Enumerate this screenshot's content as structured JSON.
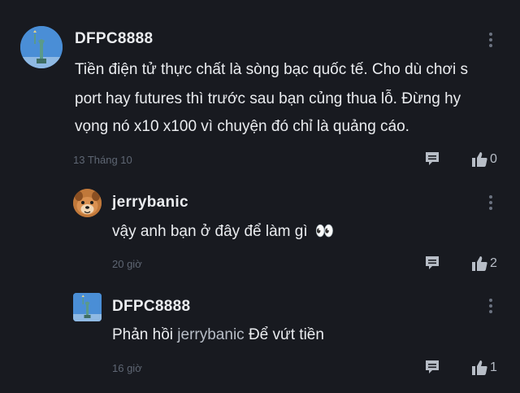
{
  "comments": [
    {
      "username": "DFPC8888",
      "text_lines": [
        "Tiền điện tử thực chất là sòng bạc quốc tế. Cho dù chơi s",
        "port hay futures thì trước sau bạn củng thua lỗ. Đừng hy",
        "vọng nó x10 x100 vì chuyện đó chỉ là quảng cáo."
      ],
      "time": "13 Tháng 10",
      "likes": "0",
      "avatar_icon": "statue-of-liberty-icon"
    },
    {
      "username": "jerrybanic",
      "text": "vậy anh bạn ở đây để làm gì",
      "emoji": "👀",
      "time": "20 giờ",
      "likes": "2",
      "avatar_icon": "dog-cartoon-icon"
    },
    {
      "username": "DFPC8888",
      "reply_prefix": "Phản hồi",
      "mention": "jerrybanic",
      "text": "Để vứt tiền",
      "time": "16 giờ",
      "likes": "1",
      "avatar_icon": "statue-of-liberty-icon"
    }
  ],
  "colors": {
    "background": "#181a20",
    "text": "#eaecef",
    "muted": "#5e6673",
    "icon": "#b7bdc6"
  }
}
